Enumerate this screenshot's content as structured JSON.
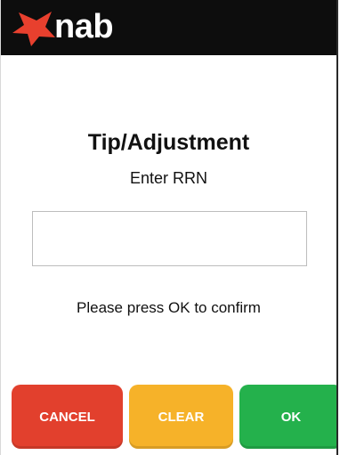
{
  "brand": {
    "name": "nab",
    "logo_icon": "nab-star-icon",
    "star_color": "#e8402e",
    "header_color": "#0d0d0d"
  },
  "screen": {
    "title": "Tip/Adjustment",
    "subtitle": "Enter RRN",
    "rrn_input": {
      "value": "",
      "placeholder": ""
    },
    "prompt": "Please press OK to confirm"
  },
  "buttons": {
    "cancel": {
      "label": "CANCEL",
      "color": "#e2402d"
    },
    "clear": {
      "label": "CLEAR",
      "color": "#f6b229"
    },
    "ok": {
      "label": "OK",
      "color": "#24b14c"
    }
  }
}
